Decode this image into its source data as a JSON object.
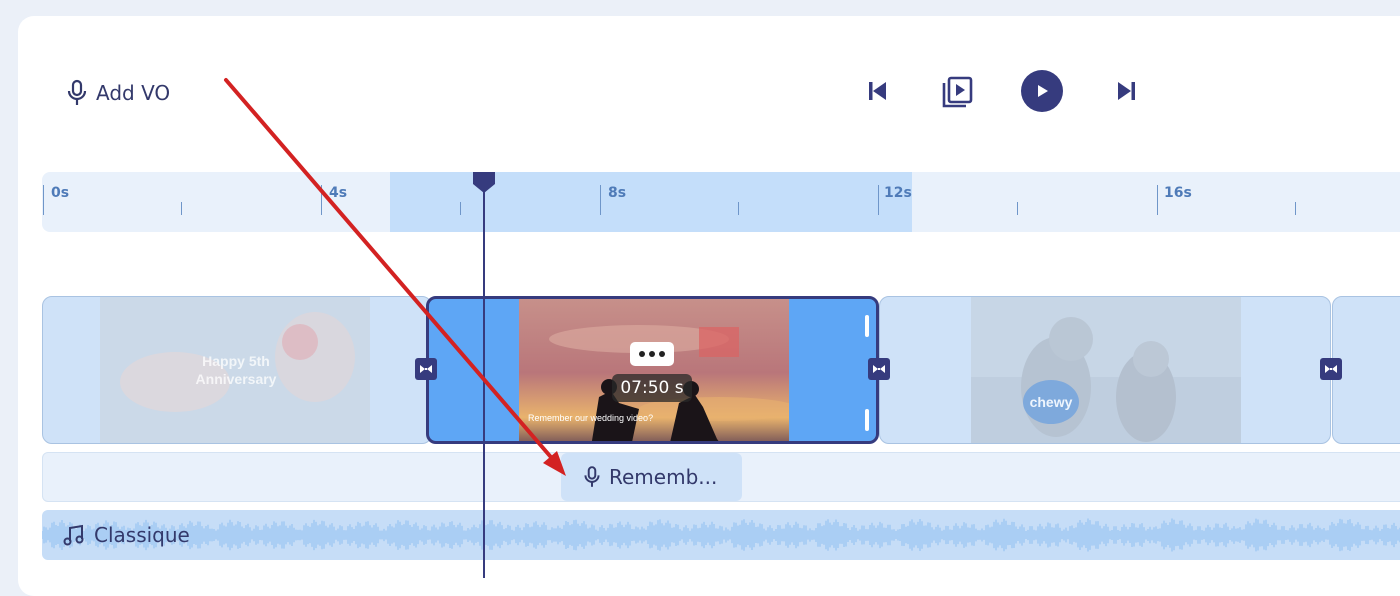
{
  "toolbar": {
    "add_vo_label": "Add VO",
    "icons": [
      "mic-icon",
      "skip-back-icon",
      "preview-icon",
      "play-icon",
      "skip-forward-icon"
    ]
  },
  "ruler": {
    "labels": [
      "0s",
      "4s",
      "8s",
      "12s",
      "16s"
    ]
  },
  "clips": [
    {
      "name": "anniversary-clip",
      "thumb_text": "Happy 5th Anniversary"
    },
    {
      "name": "sunset-clip",
      "selected": true,
      "duration": "07:50 s",
      "caption": "Remember our wedding video?"
    },
    {
      "name": "cats-clip",
      "thumb_text": "chewy"
    }
  ],
  "voiceover": {
    "label": "Rememb..."
  },
  "music": {
    "label": "Classique"
  },
  "colors": {
    "background": "#ebf0f8",
    "panel": "#ffffff",
    "accent": "#363b7e",
    "track": "#cfe2f8",
    "selected_clip": "#5ea6f5",
    "ruler_selection": "#c4defa",
    "annotation_arrow": "#d32222"
  }
}
